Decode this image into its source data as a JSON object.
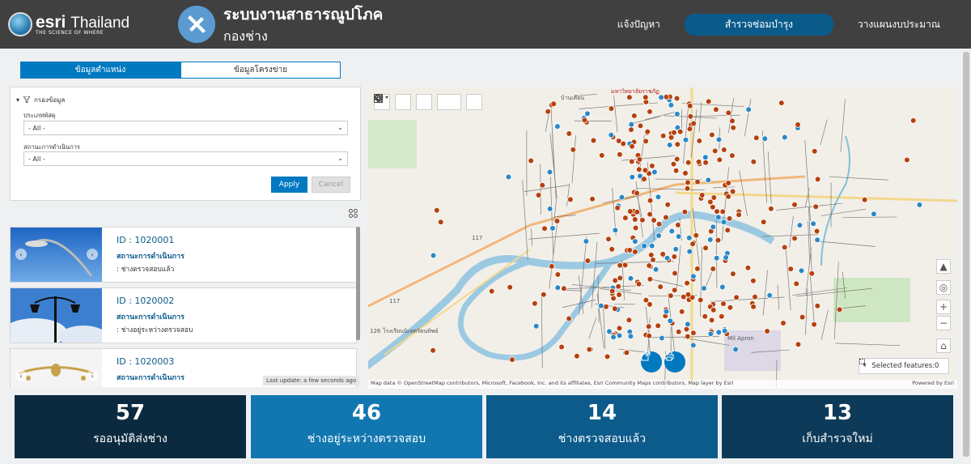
{
  "header": {
    "logo_main": "esri",
    "logo_country": "Thailand",
    "logo_tagline": "THE SCIENCE OF WHERE",
    "app_title": "ระบบงานสาธารณูปโภค",
    "app_subtitle": "กองช่าง",
    "nav": [
      {
        "label": "แจ้งปัญหา",
        "active": false
      },
      {
        "label": "สำรวจซ่อมบำรุง",
        "active": true
      },
      {
        "label": "วางแผนงบประมาณ",
        "active": false
      }
    ]
  },
  "tabs": [
    {
      "label": "ข้อมูลตำแหน่ง",
      "active": true
    },
    {
      "label": "ข้อมูลโครงข่าย",
      "active": false
    }
  ],
  "filter": {
    "title": "กรองข้อมูล",
    "field1_label": "ประเภทพัสดุ",
    "field1_value": "- All -",
    "field2_label": "สถานะการดำเนินการ",
    "field2_value": "- All -",
    "apply_label": "Apply",
    "cancel_label": "Cancel"
  },
  "list": {
    "items": [
      {
        "id": "ID : 1020001",
        "status_title": "สถานะการดำเนินการ",
        "status": ": ช่างตรวจสอบแล้ว"
      },
      {
        "id": "ID : 1020002",
        "status_title": "สถานะการดำเนินการ",
        "status": ": ช่างอยู่ระหว่างตรวจสอบ"
      },
      {
        "id": "ID : 1020003",
        "status_title": "สถานะการดำเนินการ",
        "status": ""
      }
    ],
    "last_update": "Last update: a few seconds ago"
  },
  "map": {
    "labels": [
      "บ้านเคียน",
      "มหาวิทยาลัยราชภัฏ",
      "117",
      "117",
      "126",
      "โรงเรียนนิเทศรัตนทิพย์",
      "Mil Apron"
    ],
    "selected_features": "Selected features:0",
    "attribution": "Map data © OpenStreetMap contributors, Microsoft, Facebook, Inc. and its affiliates, Esri Community Maps contributors, Map layer by Esri",
    "powered": "Powered by Esri",
    "colors": {
      "red_marker": "#b5410f",
      "blue_marker": "#2a88c8"
    }
  },
  "stats": [
    {
      "value": "57",
      "label": "รออนุมัติส่งช่าง",
      "color": "#0c2a3f"
    },
    {
      "value": "46",
      "label": "ช่างอยู่ระหว่างตรวจสอบ",
      "color": "#1277b0"
    },
    {
      "value": "14",
      "label": "ช่างตรวจสอบแล้ว",
      "color": "#0c5b8a"
    },
    {
      "value": "13",
      "label": "เก็บสำรวจใหม่",
      "color": "#0c3a58"
    }
  ]
}
